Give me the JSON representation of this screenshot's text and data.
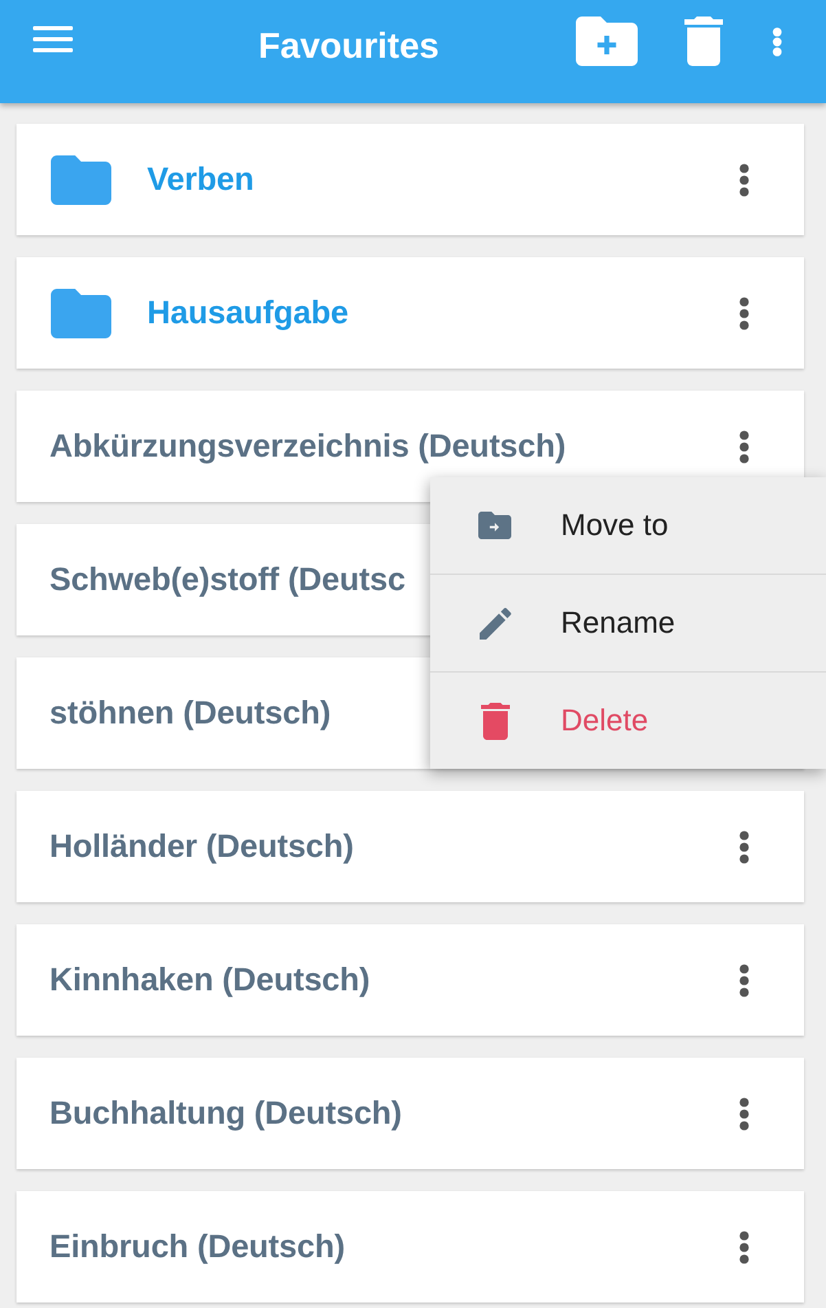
{
  "app_bar": {
    "title": "Favourites"
  },
  "rows": [
    {
      "kind": "folder",
      "label": "Verben",
      "more_button": true
    },
    {
      "kind": "folder",
      "label": "Hausaufgabe",
      "more_button": true
    },
    {
      "kind": "entry",
      "label": "Abkürzungsverzeichnis (Deutsch)",
      "more_button": true
    },
    {
      "kind": "entry",
      "label": "Schweb(e)stoff (Deutsc",
      "more_button": false
    },
    {
      "kind": "entry",
      "label": "stöhnen (Deutsch)",
      "more_button": false
    },
    {
      "kind": "entry",
      "label": "Holländer (Deutsch)",
      "more_button": true
    },
    {
      "kind": "entry",
      "label": "Kinnhaken (Deutsch)",
      "more_button": true
    },
    {
      "kind": "entry",
      "label": "Buchhaltung (Deutsch)",
      "more_button": true
    },
    {
      "kind": "entry",
      "label": "Einbruch (Deutsch)",
      "more_button": true
    }
  ],
  "context_menu": {
    "items": [
      {
        "kind": "move",
        "label": "Move to",
        "danger": false
      },
      {
        "kind": "rename",
        "label": "Rename",
        "danger": false
      },
      {
        "kind": "delete",
        "label": "Delete",
        "danger": true
      }
    ]
  }
}
